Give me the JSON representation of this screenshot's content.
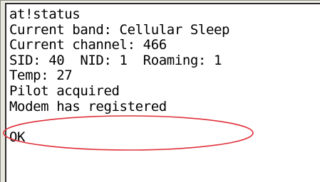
{
  "terminal": {
    "lines": [
      "at!status",
      "Current band: Cellular Sleep",
      "Current channel: 466",
      "SID: 40  NID: 1  Roaming: 1",
      "Temp: 27",
      "Pilot acquired",
      "Modem has registered",
      "",
      "OK"
    ]
  },
  "annotation": {
    "highlighted_line": "Modem has registered",
    "color": "#e0303a"
  },
  "colors": {
    "background": "#ffffff",
    "text": "#000000",
    "frame": "#f0efe6"
  }
}
